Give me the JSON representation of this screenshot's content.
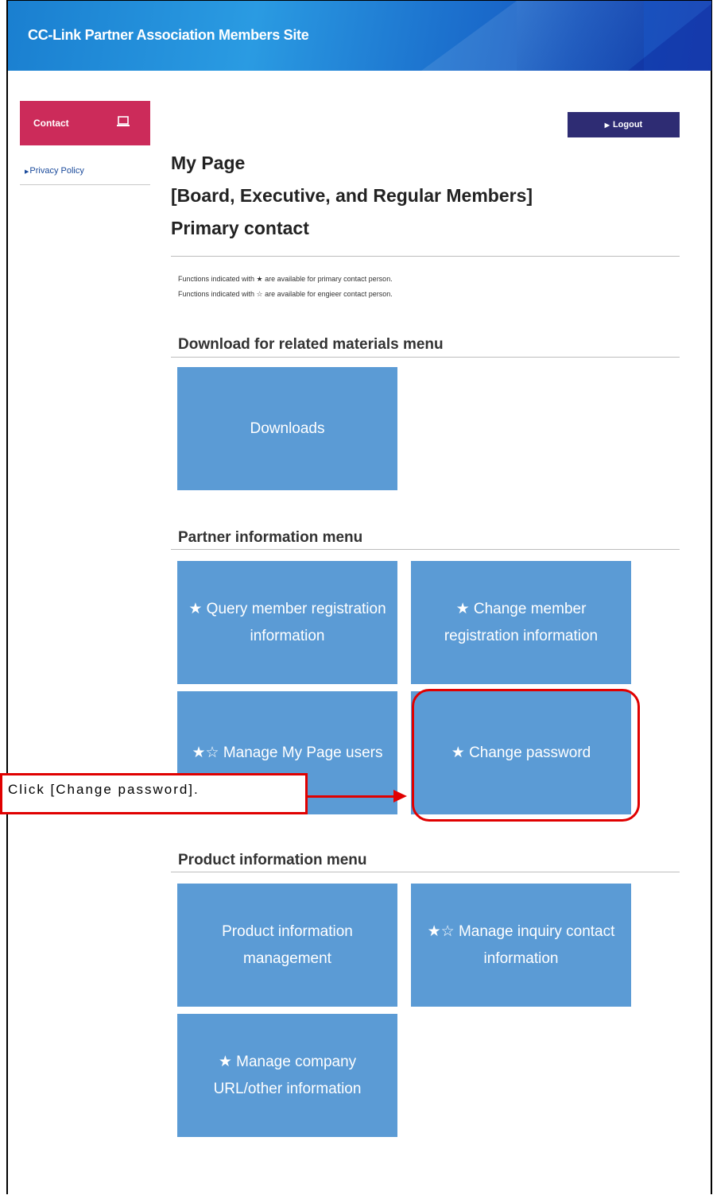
{
  "header": {
    "title": "CC-Link Partner Association Members Site"
  },
  "sidebar": {
    "contact_label": "Contact",
    "privacy_label": "Privacy Policy"
  },
  "topbar": {
    "logout_label": "Logout"
  },
  "page": {
    "title_line1": "My Page",
    "title_line2": "[Board, Executive, and Regular Members]",
    "title_line3": "Primary contact",
    "note1": "Functions indicated with ★ are available for primary contact person.",
    "note2": "Functions indicated with ☆ are available for engieer contact person."
  },
  "sections": {
    "download": {
      "heading": "Download for related materials menu",
      "tiles": [
        "Downloads"
      ]
    },
    "partner": {
      "heading": "Partner information menu",
      "tiles": [
        "★ Query member registration information",
        "★ Change member registration information",
        "★☆ Manage My Page users",
        "★ Change password"
      ]
    },
    "product": {
      "heading": "Product information menu",
      "tiles": [
        "Product information management",
        "★☆ Manage inquiry contact information",
        "★ Manage company URL/other information"
      ]
    }
  },
  "annotation": {
    "callout_text": "Click [Change password].",
    "color": "#e00000"
  },
  "colors": {
    "tile": "#5b9bd5",
    "contact": "#cc2b5a",
    "logout": "#2e2c73",
    "header": "#1d74cf"
  },
  "icons": {
    "contact": "monitor-icon",
    "logout_arrow": "triangle-right-icon",
    "privacy_arrow": "triangle-right-icon"
  }
}
